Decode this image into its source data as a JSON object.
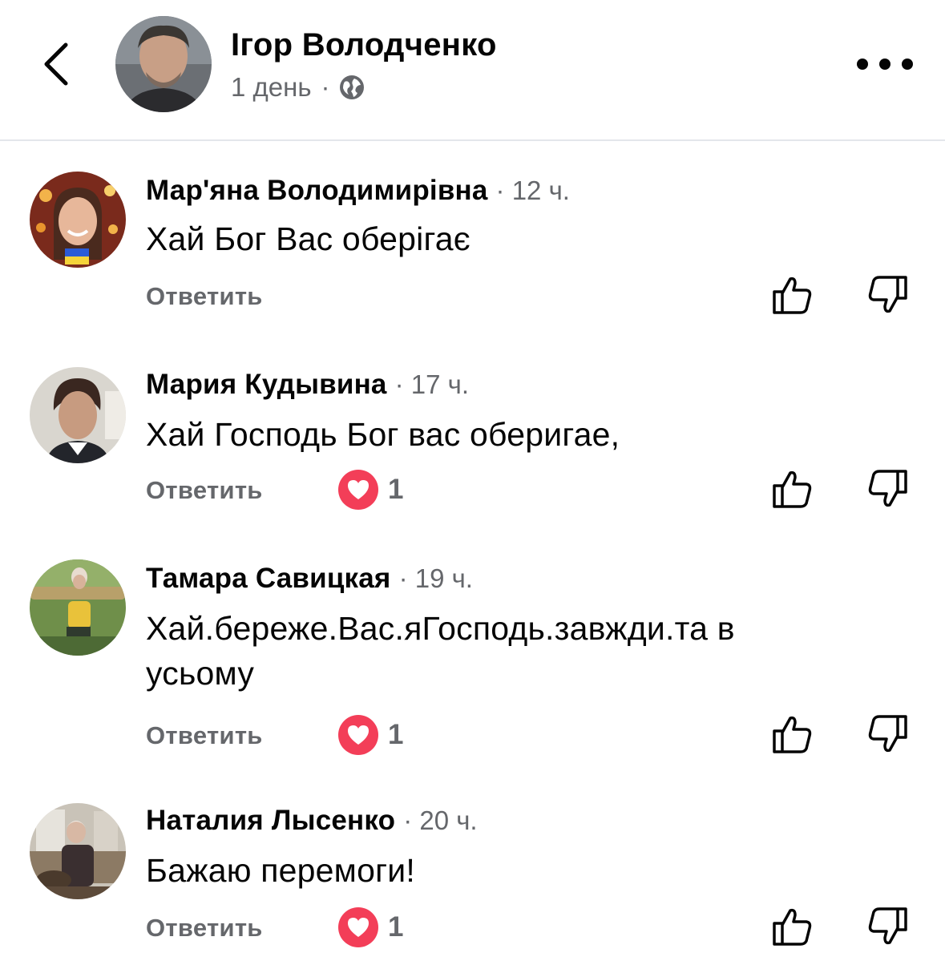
{
  "post": {
    "author": "Ігор Володченко",
    "time": "1 день",
    "separator": "·",
    "icons": {
      "back": "chevron-left-icon",
      "privacy": "globe-icon",
      "more": "more-icon"
    }
  },
  "comments": [
    {
      "author": "Мар'яна Володимирівна",
      "time": "· 12 ч.",
      "text": "Хай Бог Вас оберігає",
      "reply_label": "Ответить",
      "reactions": null
    },
    {
      "author": "Мария Кудывина",
      "time": "· 17 ч.",
      "text": "Хай Господь Бог вас оберигае,",
      "reply_label": "Ответить",
      "reactions": "1"
    },
    {
      "author": "Тамара Савицкая",
      "time": "· 19 ч.",
      "text": "Хай.береже.Вас.яГосподь.завжди.та в усьому",
      "reply_label": "Ответить",
      "reactions": "1"
    },
    {
      "author": "Наталия Лысенко",
      "time": "· 20 ч.",
      "text": "Бажаю перемоги!",
      "reply_label": "Ответить",
      "reactions": "1"
    }
  ],
  "colors": {
    "text": "#050505",
    "secondary": "#65676b",
    "love": "#f33e58",
    "divider": "#e4e6eb"
  }
}
